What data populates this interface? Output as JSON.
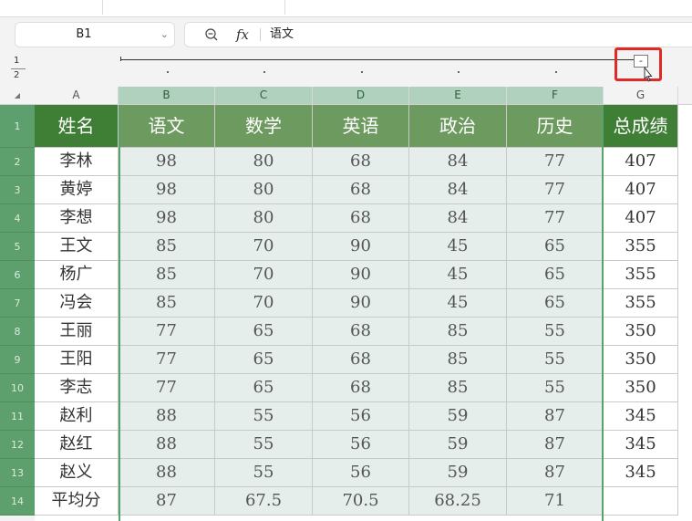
{
  "namebox": {
    "value": "B1"
  },
  "formula": {
    "content": "语文"
  },
  "outline": {
    "levels": [
      "1",
      "2"
    ],
    "collapse_label": "-"
  },
  "columns": [
    "A",
    "B",
    "C",
    "D",
    "E",
    "F",
    "G"
  ],
  "rows": [
    "1",
    "2",
    "3",
    "4",
    "5",
    "6",
    "7",
    "8",
    "9",
    "10",
    "11",
    "12",
    "13",
    "14"
  ],
  "table": {
    "header": [
      "姓名",
      "语文",
      "数学",
      "英语",
      "政治",
      "历史",
      "总成绩"
    ],
    "body": [
      [
        "李林",
        "98",
        "80",
        "68",
        "84",
        "77",
        "407"
      ],
      [
        "黄婷",
        "98",
        "80",
        "68",
        "84",
        "77",
        "407"
      ],
      [
        "李想",
        "98",
        "80",
        "68",
        "84",
        "77",
        "407"
      ],
      [
        "王文",
        "85",
        "70",
        "90",
        "45",
        "65",
        "355"
      ],
      [
        "杨广",
        "85",
        "70",
        "90",
        "45",
        "65",
        "355"
      ],
      [
        "冯会",
        "85",
        "70",
        "90",
        "45",
        "65",
        "355"
      ],
      [
        "王丽",
        "77",
        "65",
        "68",
        "85",
        "55",
        "350"
      ],
      [
        "王阳",
        "77",
        "65",
        "68",
        "85",
        "55",
        "350"
      ],
      [
        "李志",
        "77",
        "65",
        "68",
        "85",
        "55",
        "350"
      ],
      [
        "赵利",
        "88",
        "55",
        "56",
        "59",
        "87",
        "345"
      ],
      [
        "赵红",
        "88",
        "55",
        "56",
        "59",
        "87",
        "345"
      ],
      [
        "赵义",
        "88",
        "55",
        "56",
        "59",
        "87",
        "345"
      ],
      [
        "平均分",
        "87",
        "67.5",
        "70.5",
        "68.25",
        "71",
        ""
      ]
    ]
  },
  "colors": {
    "header_green": "#3f7e35",
    "header_selected": "#6c9a5f",
    "selected_fill": "#e6eeeb",
    "highlight_red": "#e02a26"
  }
}
